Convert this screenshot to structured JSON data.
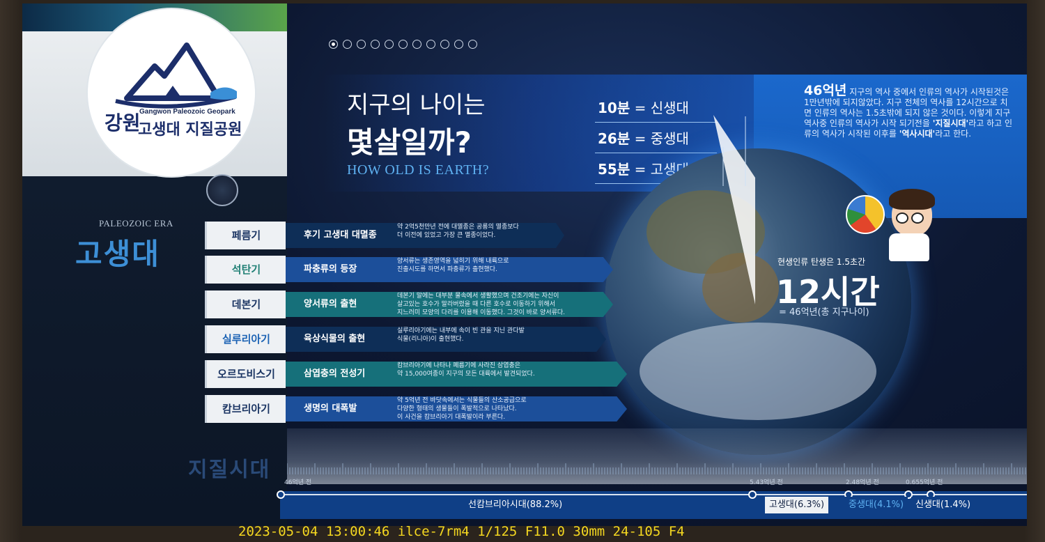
{
  "logo": {
    "ko_big": "강원",
    "en": "Gangwon Paleozoic Geopark",
    "ko": "고생대 지질공원"
  },
  "era": {
    "en": "PALEOZOIC ERA",
    "ko": "고생대"
  },
  "geologic_time_label": "지질시대",
  "pagination": {
    "total": 11,
    "active_index": 0
  },
  "headline": {
    "line1": "지구의 나이는",
    "line2": "몇살일까?",
    "english": "HOW OLD IS EARTH?"
  },
  "era_minutes": [
    {
      "min": "10분",
      "era": "= 신생대"
    },
    {
      "min": "26분",
      "era": "= 중생대"
    },
    {
      "min": "55분",
      "era": "= 고생대"
    }
  ],
  "info": {
    "big": "46억년",
    "text1": " 지구의 역사 중에서 인류의 역사가 시작된것은 1만년밖에 되지않았다. 지구 전체의 역사를 12시간으로 치면 인류의 역사는 1.5초밖에 되지 않은 것이다. 이렇게 지구 역사중 인류의 역사가 시작 되기전을 ",
    "bold1": "'지질시대'",
    "text2": "라고 하고 인류의 역사가 시작된 이후를 ",
    "bold2": "'역사시대'",
    "text3": "라고 한다."
  },
  "human": {
    "small": "현생인류 탄생은 1.5초간",
    "big": "12시간",
    "eq": "= 46억년(총 지구나이)"
  },
  "periods": [
    {
      "name": "페름기",
      "event": "후기 고생대 대멸종",
      "desc": "약 2억5천만년 전에 대멸종은 공룡의 멸종보다\n더 이전에 있었고 가장 큰 멸종이었다.",
      "tab_color": "#1b3563",
      "bar": "#0e2e57"
    },
    {
      "name": "석탄기",
      "event": "파충류의 등장",
      "desc": "양서류는 생존영역을 넓히기 위해 내륙으로\n진출시도를 하면서 파충류가 출현했다.",
      "tab_color": "#1f7f74",
      "bar": "#1c4f9a"
    },
    {
      "name": "데본기",
      "event": "양서류의 출현",
      "desc": "데본기 말에는 대부분 물속에서 생활했으며 건조기에는 자신이\n살고있는 호수가 말라버렸을 때 다른 호수로 이동하기 위해서\n지느러미 모양의 다리를 이용해 이동했다. 그것이 바로 양서류다.",
      "tab_color": "#1b3563",
      "bar": "#16707a"
    },
    {
      "name": "실루리아기",
      "event": "육상식물의 출현",
      "desc": "실루리아기에는 내부에 속이 빈 관을 지닌 관다발\n식물(리니아)이 출현했다.",
      "tab_color": "#1c63b4",
      "bar": "#0e2e57"
    },
    {
      "name": "오르도비스기",
      "event": "삼엽충의 전성기",
      "desc": "캄브리아기에 나타나 페름기에 사라진 삼엽충은\n약 15,000여종이 지구의 모든 대륙에서 발견되었다.",
      "tab_color": "#1b3563",
      "bar": "#16707a"
    },
    {
      "name": "캄브리아기",
      "event": "생명의 대폭발",
      "desc": "약 5억년 전 바닷속에서는 식물들의 산소공급으로\n다양한 형태의 생물들이 폭발적으로 나타났다.\n이 사건을 캄브리아기 대폭발이라 부른다.",
      "tab_color": "#1b3563",
      "bar": "#1c4f9a"
    }
  ],
  "ruler_labels": {
    "start": "46억년 전",
    "paleo": "5.43억년 전",
    "meso": "2.48억년 전",
    "ceno": "0.655억년 전"
  },
  "timeline": {
    "precambrian": "선캄브리아시대(88.2%)",
    "paleozoic": "고생대(6.3%)",
    "mesozoic": "중생대(4.1%)",
    "cenozoic": "신생대(1.4%)"
  },
  "stamp": "2023-05-04 13:00:46 ilce-7rm4 1/125 F11.0 30mm 24-105 F4",
  "colors": {
    "accent_blue": "#1d6cd0",
    "era_blue": "#3d8fd6",
    "stamp_yellow": "#f5d820"
  }
}
